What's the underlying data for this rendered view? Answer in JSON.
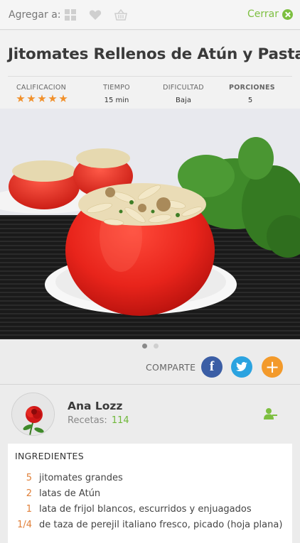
{
  "topbar": {
    "add_label": "Agregar a:",
    "icons": [
      "grid-icon",
      "heart-icon",
      "basket-icon"
    ],
    "close_label": "Cerrar"
  },
  "recipe": {
    "title": "Jitomates Rellenos de Atún y Pasta",
    "stats": {
      "rating_label": "CALIFICACION",
      "rating_stars": 5,
      "time_label": "TIEMPO",
      "time_value": "15 min",
      "difficulty_label": "DIFICULTAD",
      "difficulty_value": "Baja",
      "servings_label": "PORCIONES",
      "servings_value": "5"
    }
  },
  "carousel": {
    "count": 2,
    "active": 0
  },
  "share": {
    "label": "COMPARTE",
    "buttons": [
      {
        "name": "facebook",
        "glyph": "f",
        "color": "#3b5ea5"
      },
      {
        "name": "twitter",
        "glyph": "t",
        "color": "#2ba3e0"
      },
      {
        "name": "add",
        "glyph": "+",
        "color": "#f39a2b"
      }
    ]
  },
  "author": {
    "name": "Ana Lozz",
    "recipes_label": "Recetas:",
    "recipes_count": "114"
  },
  "ingredients": {
    "title": "INGREDIENTES",
    "items": [
      {
        "qty": "5",
        "text": "jitomates grandes"
      },
      {
        "qty": "2",
        "text": "latas de Atún"
      },
      {
        "qty": "1",
        "text": "lata de frijol blancos, escurridos y enjuagados"
      },
      {
        "qty": "1/4",
        "text": "de taza de perejil italiano fresco, picado (hoja plana)"
      }
    ]
  },
  "colors": {
    "accent_green": "#7dbf40",
    "accent_orange": "#f1902a"
  }
}
